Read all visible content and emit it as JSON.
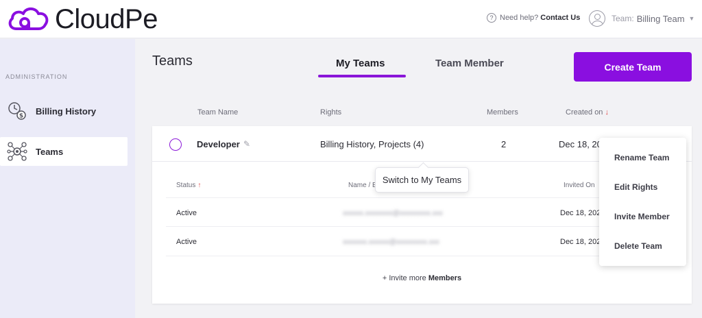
{
  "app": {
    "name": "CloudPe",
    "brand_color": "#8a0fe0"
  },
  "header": {
    "help_text": "Need help?",
    "contact_label": "Contact Us",
    "team_prefix": "Team:",
    "team_name": "Billing Team"
  },
  "sidebar": {
    "section_label": "ADMINISTRATION",
    "items": [
      {
        "label": "Billing History",
        "icon": "billing-clock-icon"
      },
      {
        "label": "Teams",
        "icon": "teams-network-icon"
      }
    ]
  },
  "main": {
    "title": "Teams",
    "tabs": [
      {
        "label": "My Teams"
      },
      {
        "label": "Team Member"
      }
    ],
    "create_button": "Create Team",
    "columns": {
      "name": "Team Name",
      "rights": "Rights",
      "members": "Members",
      "created": "Created on"
    },
    "team": {
      "name": "Developer",
      "rights": "Billing History, Projects (4)",
      "members": "2",
      "created": "Dec 18, 20"
    },
    "member_columns": {
      "status": "Status",
      "name": "Name / Er",
      "invited": "Invited On"
    },
    "member_rows": [
      {
        "status": "Active",
        "email": "xxxxxx.xxxxxxxx@xxxxxxxxx.xxx",
        "invited": "Dec 18, 202"
      },
      {
        "status": "Active",
        "email": "xxxxxxx.xxxxxx@xxxxxxxxx.xxx",
        "invited": "Dec 18, 202"
      }
    ],
    "invite_prefix": "+ Invite more",
    "invite_bold": "Members"
  },
  "tooltip": "Switch to My Teams",
  "menu": [
    "Rename Team",
    "Edit Rights",
    "Invite Member",
    "Delete Team"
  ]
}
